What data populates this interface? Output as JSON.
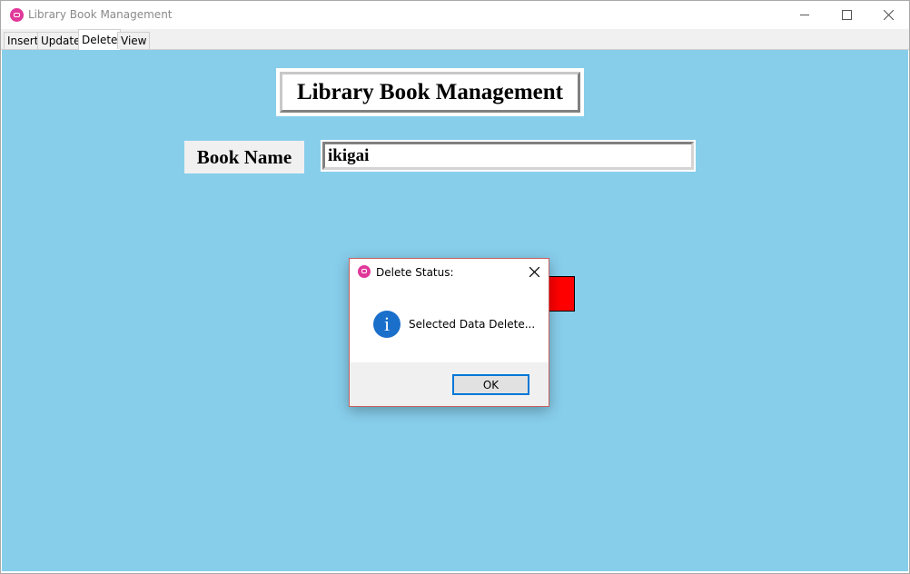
{
  "window": {
    "title": "Library Book Management",
    "icon": "app-icon"
  },
  "tabs": [
    {
      "label": "Insert"
    },
    {
      "label": "Update"
    },
    {
      "label": "Delete",
      "active": true
    },
    {
      "label": "View"
    }
  ],
  "form": {
    "heading": "Library Book Management",
    "book_name_label": "Book Name",
    "book_name_value": "ikigai",
    "delete_button_color": "#ff0000"
  },
  "dialog": {
    "title": "Delete Status:",
    "message": "Selected Data Delete...",
    "ok_label": "OK",
    "icon": "info-icon"
  },
  "colors": {
    "background": "#87ceeb",
    "accent": "#0078d7"
  }
}
